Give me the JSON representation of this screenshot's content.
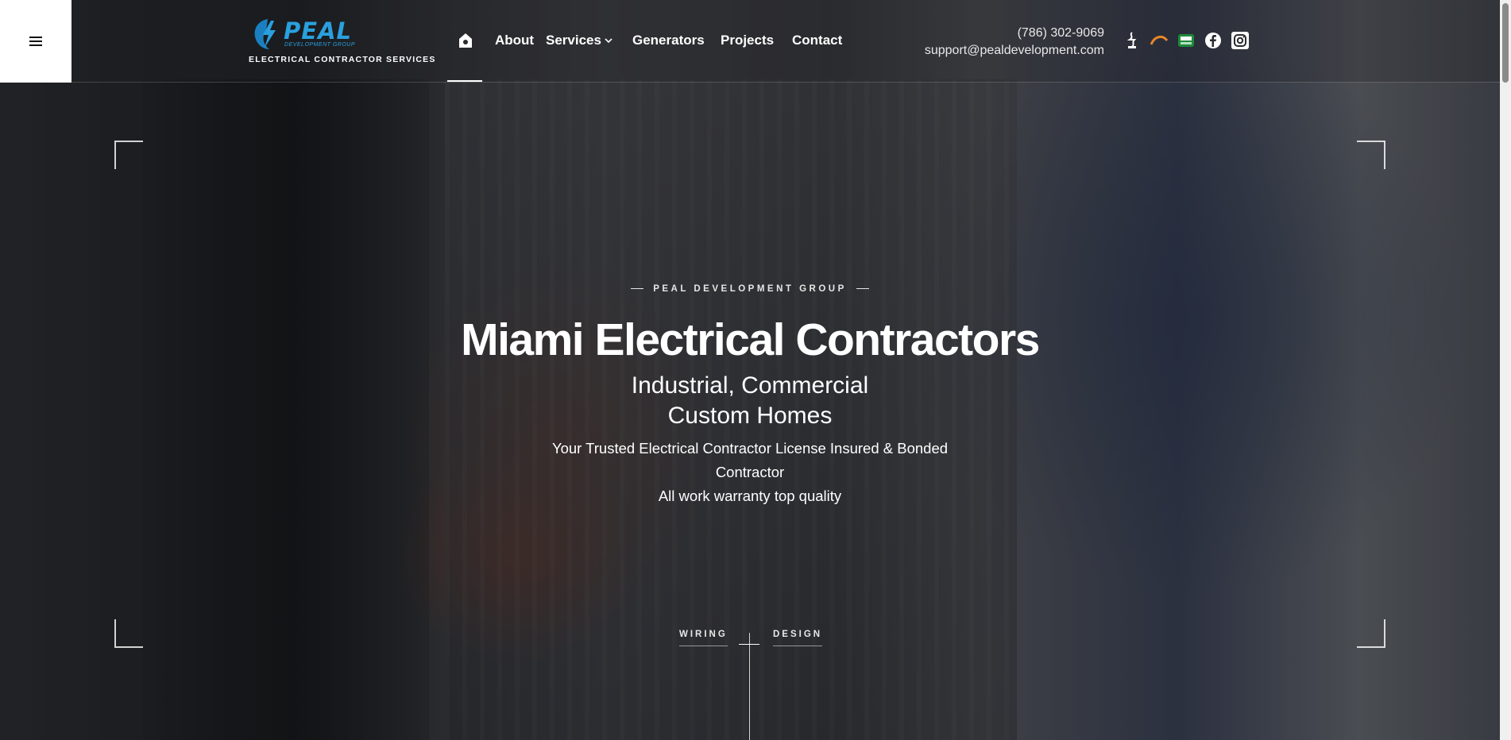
{
  "header": {
    "logo": {
      "word": "PEAL",
      "sub": "DEVELOPMENT GROUP",
      "tagline": "ELECTRICAL CONTRACTOR SERVICES"
    },
    "nav": [
      {
        "label": "About"
      },
      {
        "label": "Services"
      },
      {
        "label": "Generators"
      },
      {
        "label": "Projects"
      },
      {
        "label": "Contact"
      }
    ],
    "phone": "(786) 302-9069",
    "email": "support@pealdevelopment.com",
    "social_icons": [
      "bbb-icon",
      "angi-icon",
      "license-badge-icon",
      "facebook-icon",
      "instagram-icon"
    ]
  },
  "hero": {
    "eyebrow": "PEAL DEVELOPMENT GROUP",
    "title": "Miami Electrical Contractors",
    "subtitle_line1": "Industrial, Commercial",
    "subtitle_line2": "Custom Homes",
    "desc_line1": "Your Trusted Electrical Contractor License Insured & Bonded",
    "desc_line2": "Contractor",
    "desc_line3": "All work warranty top quality",
    "pill_left": "WIRING",
    "pill_right": "DESIGN"
  },
  "colors": {
    "brand_blue": "#2aa0de",
    "menu_button_bg": "#ffffff"
  }
}
